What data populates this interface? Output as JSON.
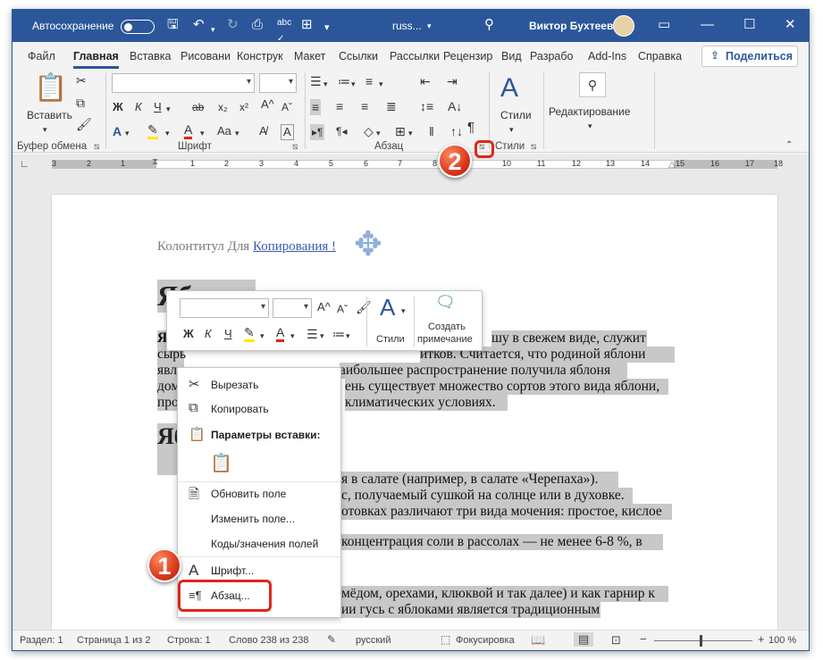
{
  "titlebar": {
    "autosave_label": "Автосохранение",
    "doc_name": "russ...",
    "user_name": "Виктор Бухтеев",
    "accent": "#2b579a"
  },
  "menu": {
    "tabs": [
      "Файл",
      "Главная",
      "Вставка",
      "Рисовани",
      "Конструк",
      "Макет",
      "Ссылки",
      "Рассылки",
      "Рецензир",
      "Вид",
      "Разрабо",
      "Add-Ins",
      "Справка"
    ],
    "share_label": "Поделиться"
  },
  "ribbon": {
    "paste_label": "Вставить",
    "styles_label": "Стили",
    "editing_label": "Редактирование",
    "groups": {
      "clipboard": "Буфер обмена",
      "font": "Шрифт",
      "paragraph": "Абзац",
      "styles": "Стили"
    },
    "bold": "Ж",
    "italic": "К",
    "underline": "Ч"
  },
  "ruler": {
    "numbers": [
      "3",
      "2",
      "1",
      "1",
      "2",
      "3",
      "4",
      "5",
      "6",
      "7",
      "8",
      "9",
      "10",
      "11",
      "12",
      "13",
      "14",
      "15",
      "16",
      "17",
      "18"
    ]
  },
  "document": {
    "header_text": "Колонтитул Для ",
    "header_link": "Копирования !",
    "heading1": "Яблоко",
    "heading2": "Яб",
    "lines": [
      {
        "prefix": "Ябл",
        "text": "шу в свежем виде, служит"
      },
      {
        "prefix": "сырь",
        "text": "итков. Считается, что родиной яблони"
      },
      {
        "prefix": "явля",
        "text": "аибольшее распространение получила яблоня"
      },
      {
        "prefix": "дом",
        "text": "ень существует множество сортов этого вида яблони,"
      },
      {
        "prefix": "про",
        "text": "климатических условиях."
      }
    ],
    "lines2": [
      "я в салате (например, в салате «Черепаха»).",
      "с, получаемый сушкой на солнце или в духовке.",
      "отовках различают три вида мочения: простое, кислое",
      "концентрация соли в рассолах — не менее 6-8 %, в",
      "мёдом, орехами, клюквой и так далее) и как гарнир к",
      "ии гусь с яблоками является традиционным"
    ]
  },
  "mini_toolbar": {
    "styles_label": "Стили",
    "comment_label_1": "Создать",
    "comment_label_2": "примечание"
  },
  "context_menu": {
    "cut": "Вырезать",
    "copy": "Копировать",
    "paste_options": "Параметры вставки:",
    "update_field": "Обновить поле",
    "edit_field": "Изменить поле...",
    "field_codes": "Коды/значения полей",
    "font": "Шрифт...",
    "paragraph": "Абзац..."
  },
  "status": {
    "section": "Раздел: 1",
    "page": "Страница 1 из 2",
    "line": "Строка: 1",
    "words": "Слово 238 из 238",
    "language": "русский",
    "focus": "Фокусировка",
    "zoom": "100 %"
  },
  "badges": {
    "one": "1",
    "two": "2"
  }
}
